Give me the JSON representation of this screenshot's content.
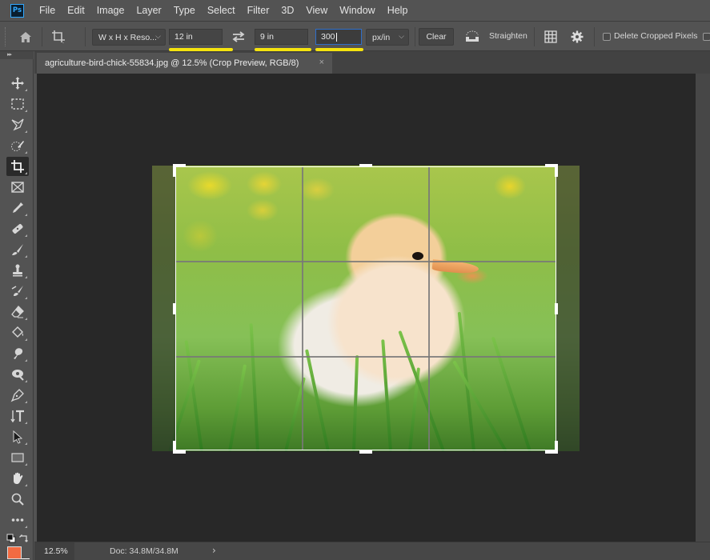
{
  "app": {
    "logo": "Ps"
  },
  "menu": [
    "File",
    "Edit",
    "Image",
    "Layer",
    "Type",
    "Select",
    "Filter",
    "3D",
    "View",
    "Window",
    "Help"
  ],
  "options": {
    "ratio_preset": "W x H x Reso...",
    "width_value": "12 in",
    "height_value": "9 in",
    "resolution_value": "300",
    "resolution_unit": "px/in",
    "clear_label": "Clear",
    "straighten_label": "Straighten",
    "delete_cropped_label": "Delete Cropped Pixels",
    "delete_cropped_checked": false,
    "highlight_color": "#f5e30e"
  },
  "document": {
    "tab_title": "agriculture-bird-chick-55834.jpg @ 12.5% (Crop Preview, RGB/8)",
    "close_glyph": "×"
  },
  "tools": [
    {
      "name": "move-tool",
      "icon": "move-icon"
    },
    {
      "name": "marquee-tool",
      "icon": "rect-marquee-icon"
    },
    {
      "name": "lasso-tool",
      "icon": "polygonal-lasso-icon"
    },
    {
      "name": "quick-selection-tool",
      "icon": "quick-selection-icon"
    },
    {
      "name": "crop-tool",
      "icon": "crop-icon",
      "active": true
    },
    {
      "name": "frame-tool",
      "icon": "frame-icon"
    },
    {
      "name": "eyedropper-tool",
      "icon": "eyedropper-icon"
    },
    {
      "name": "healing-brush-tool",
      "icon": "bandage-icon"
    },
    {
      "name": "brush-tool",
      "icon": "brush-icon"
    },
    {
      "name": "clone-stamp-tool",
      "icon": "stamp-icon"
    },
    {
      "name": "history-brush-tool",
      "icon": "history-brush-icon"
    },
    {
      "name": "eraser-tool",
      "icon": "eraser-icon"
    },
    {
      "name": "paint-bucket-tool",
      "icon": "paint-bucket-icon"
    },
    {
      "name": "smudge-tool",
      "icon": "smudge-icon"
    },
    {
      "name": "dodge-tool",
      "icon": "dodge-icon"
    },
    {
      "name": "pen-tool",
      "icon": "pen-icon"
    },
    {
      "name": "type-tool",
      "icon": "vertical-type-icon"
    },
    {
      "name": "path-selection-tool",
      "icon": "arrow-icon"
    },
    {
      "name": "rectangle-tool",
      "icon": "rectangle-icon"
    },
    {
      "name": "hand-tool",
      "icon": "hand-icon"
    },
    {
      "name": "zoom-tool",
      "icon": "magnifier-icon"
    },
    {
      "name": "more-tools",
      "icon": "ellipsis-icon"
    }
  ],
  "colors": {
    "foreground": "#f26b42",
    "background": "#ffffff"
  },
  "status": {
    "zoom": "12.5%",
    "doc_size": "Doc: 34.8M/34.8M",
    "arrow": "›"
  }
}
